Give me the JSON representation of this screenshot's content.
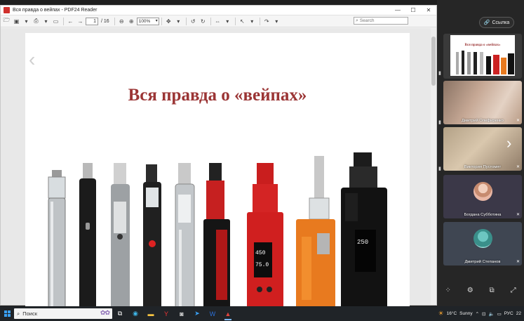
{
  "window": {
    "title": "Вся правда о вейпах - PDF24 Reader",
    "controls": {
      "minimize": "—",
      "maximize": "☐",
      "close": "✕"
    }
  },
  "toolbar": {
    "page_current": "1",
    "page_separator": "/",
    "page_total": "16",
    "zoom": "100%",
    "search_placeholder": "Search"
  },
  "slide": {
    "title": "Вся правда о «вейпах»"
  },
  "meeting": {
    "link_button": "Ссылка",
    "participants": [
      {
        "name": "Дмитрий Олефиренко"
      },
      {
        "name": "Виктория Пустомят"
      },
      {
        "name": "Богдана Субботина"
      },
      {
        "name": "Дмитрий Степанов"
      }
    ],
    "thumb_slide_title": "Вся правда о «вейпах»"
  },
  "taskbar": {
    "search_text": "Поиск",
    "temperature": "16°C",
    "weather": "Sunny",
    "language": "РУС",
    "clock": "22"
  },
  "colors": {
    "title_red": "#9b3535",
    "taskbar_bg": "#202428",
    "panel_bg": "#262626"
  }
}
